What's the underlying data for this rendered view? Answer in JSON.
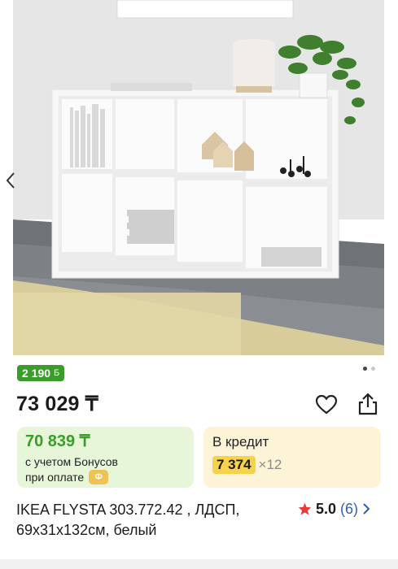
{
  "product": {
    "bonus_badge": "2 190",
    "bonus_badge_icon": "bonus-b-icon",
    "price": "73 029 ₸",
    "title": "IKEA FLYSTA 303.772.42 , ЛДСП, 69х31х132см, белый",
    "rating_value": "5.0",
    "reviews_count": "(6)"
  },
  "bonus_offer": {
    "price": "70 839 ₸",
    "line1": "с учетом Бонусов",
    "line2": "при оплате",
    "coin_symbol": "Ф"
  },
  "credit": {
    "title": "В кредит",
    "monthly": "7 374",
    "months": "×12"
  },
  "gallery": {
    "active_index": 0,
    "total": 2
  },
  "icons": {
    "favorite": "heart-icon",
    "share": "share-icon",
    "rating": "star-icon",
    "reviews": "chevron-right-icon",
    "prev": "chevron-left-icon"
  },
  "colors": {
    "green": "#3a9d2a",
    "bonus_bg": "#e7f6d9",
    "credit_bg": "#fdf4d7",
    "credit_highlight": "#f7d34b",
    "star": "#e53b3b",
    "link": "#2f5fb3"
  }
}
